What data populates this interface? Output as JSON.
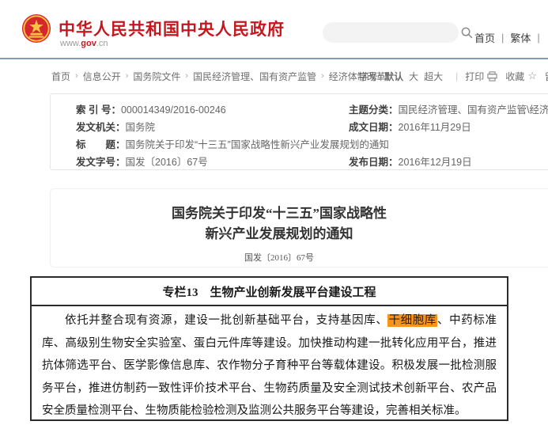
{
  "header": {
    "site_title": "中华人民共和国中央人民政府",
    "url_prefix": "www.",
    "url_gov": "gov",
    "url_suffix": ".cn",
    "sep": "|",
    "nav": [
      "首页",
      "繁体"
    ]
  },
  "breadcrumb": {
    "sep": "›",
    "items": [
      "首页",
      "信息公开",
      "国务院文件",
      "国民经济管理、国有资产监管",
      "经济体制改革"
    ],
    "fontsize": {
      "label": "字号:",
      "options": [
        "默认",
        "大",
        "超大"
      ]
    },
    "tools": [
      {
        "label": "打印",
        "icon": "printer"
      },
      {
        "label": "收藏",
        "glyph": "☆"
      },
      {
        "label": "留言",
        "glyph": "✎"
      }
    ],
    "pipe": "|"
  },
  "meta": {
    "rows": [
      {
        "label": "索 引 号：",
        "value": "000014349/2016-00246",
        "label2": "主题分类：",
        "value2": "国民经济管理、国有资产监管\\经济体制改革"
      },
      {
        "label": "发文机关：",
        "value": "国务院",
        "label2": "成文日期：",
        "value2": "2016年11月29日"
      },
      {
        "label": "标　　题：",
        "value": "国务院关于印发“十三五”国家战略性新兴产业发展规划的通知"
      },
      {
        "label": "发文字号：",
        "value": "国发〔2016〕67号",
        "label2": "发布日期：",
        "value2": "2016年12月19日"
      }
    ]
  },
  "doc": {
    "title_line1": "国务院关于印发“十三五”国家战略性",
    "title_line2": "新兴产业发展规划的通知",
    "doc_number": "国发〔2016〕67号"
  },
  "column_box": {
    "heading": "专栏13　生物产业创新发展平台建设工程",
    "body_before": "依托并整合现有资源，建设一批创新基础平台，支持基因库、",
    "highlight": "干细胞库",
    "body_after": "、中药标准库、高级别生物安全实验室、蛋白元件库等建设。加快推动构建一批转化应用平台，推进抗体筛选平台、医学影像信息库、农作物分子育种平台等载体建设。积极发展一批检测服务平台，推进仿制药一致性评价技术平台、生物药质量及安全测试技术创新平台、农产品安全质量检测平台、生物质能检验检测及监测公共服务平台等建设，完善相关标准。"
  },
  "colors": {
    "brand_red": "#c8161e",
    "divider_blue": "#7e9db9",
    "link_blue": "#2a66a8",
    "highlight_orange": "#f7941e"
  }
}
